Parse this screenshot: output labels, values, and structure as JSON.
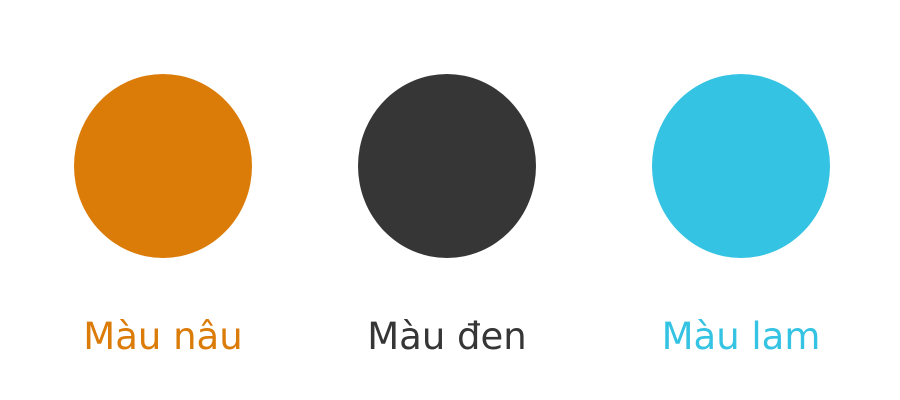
{
  "swatches": [
    {
      "label": "Màu nâu",
      "color": "#DB7B08"
    },
    {
      "label": "Màu đen",
      "color": "#363636"
    },
    {
      "label": "Màu lam",
      "color": "#34C3E2"
    }
  ]
}
